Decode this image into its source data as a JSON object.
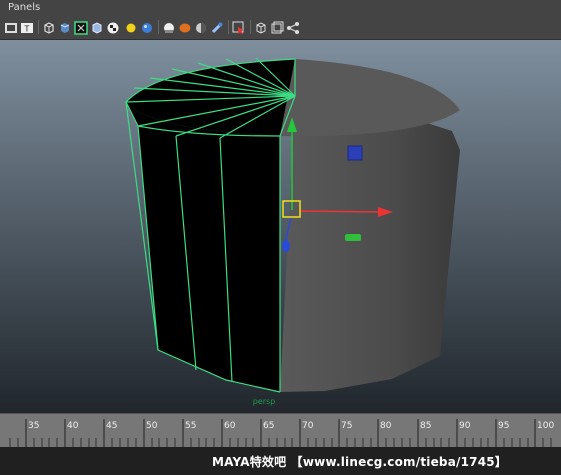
{
  "menu": {
    "panels_label": "Panels"
  },
  "toolbar": {
    "icons": [
      "select-camera-icon",
      "grid-icon",
      "text-icon",
      "cube-icon",
      "wire-cube-icon",
      "frame-selected-icon",
      "shaded-cube-icon",
      "checker-icon",
      "sun-light-icon",
      "blue-sphere-icon",
      "white-sphere-icon",
      "orange-sphere-icon",
      "half-sphere-icon",
      "pin-icon",
      "select-arrow-icon",
      "cube-wire-icon",
      "cube-frame-icon",
      "node-icon"
    ]
  },
  "viewport": {
    "camera_label": "persp",
    "wire_color": "#3ddc84",
    "gradient_top": "#7f8f9e",
    "gradient_bottom": "#20262c"
  },
  "timeline": {
    "ticks": [
      "35",
      "40",
      "45",
      "50",
      "55",
      "60",
      "65",
      "70",
      "75",
      "80",
      "85",
      "90",
      "95",
      "100"
    ]
  },
  "watermark": {
    "text": "MAYA特效吧  【www.linecg.com/tieba/1745】"
  }
}
